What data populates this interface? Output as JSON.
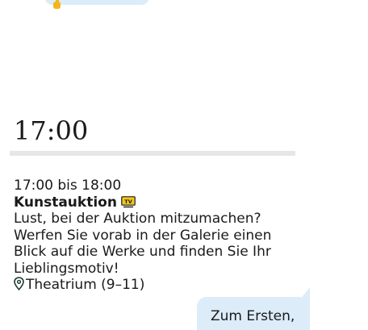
{
  "heading": {
    "time": "17:00"
  },
  "event": {
    "time_range": "17:00 bis 18:00",
    "title": "Kunstauktion",
    "title_icon": "tv-icon",
    "description_lines": [
      "Lust, bei der Auktion mitzumachen?",
      "Werfen Sie vorab in der Galerie einen",
      "Blick auf die Werke und finden Sie Ihr",
      "Lieblingsmotiv!"
    ],
    "location_icon": "location-pin-icon",
    "location": "Theatrium (9–11)"
  },
  "top_bubble": {
    "icon": "thumbs-up-icon"
  },
  "speech_bubble": {
    "text": "Zum Ersten,"
  },
  "colors": {
    "bubble": "#dcecf9",
    "divider": "#e6e6e6",
    "text": "#1a1a1a",
    "tv_icon": "#f2c81a",
    "pin_icon": "#1a3b2e"
  }
}
